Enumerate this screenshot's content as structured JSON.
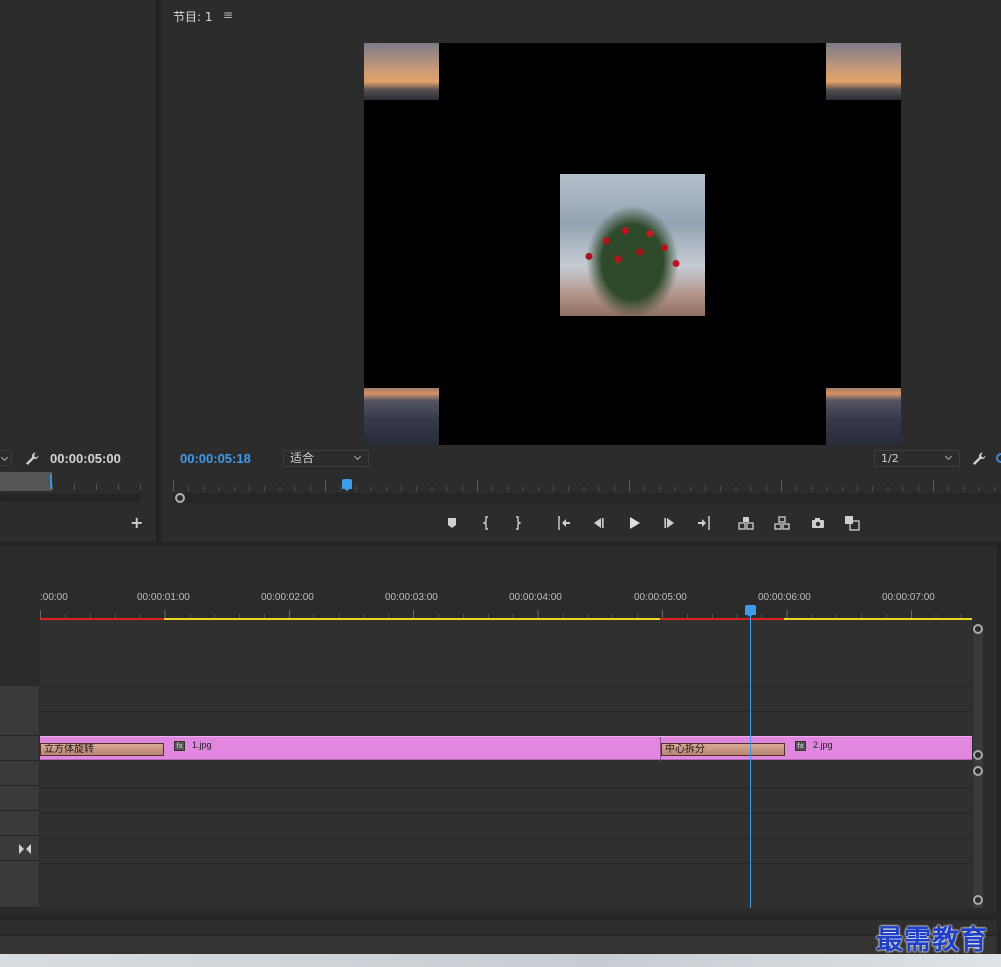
{
  "source": {
    "timecode": "00:00:05:00",
    "add_label": "+"
  },
  "program": {
    "title": "节目: 1",
    "menu_icon": "≡",
    "timecode": "00:00:05:18",
    "fit_select": "适合",
    "resolution_select": "1/2",
    "playhead_position_seconds": 5.75
  },
  "transport": [
    {
      "name": "add-marker-icon"
    },
    {
      "name": "mark-in-icon"
    },
    {
      "name": "mark-out-icon"
    },
    {
      "name": "go-to-in-icon"
    },
    {
      "name": "step-back-icon"
    },
    {
      "name": "play-icon"
    },
    {
      "name": "step-forward-icon"
    },
    {
      "name": "go-to-out-icon"
    },
    {
      "name": "lift-icon"
    },
    {
      "name": "extract-icon"
    },
    {
      "name": "export-frame-icon"
    },
    {
      "name": "comparison-view-icon"
    }
  ],
  "timeline": {
    "ruler_labels": [
      ":00:00",
      "00:00:01:00",
      "00:00:02:00",
      "00:00:03:00",
      "00:00:04:00",
      "00:00:05:00",
      "00:00:06:00",
      "00:00:07:00"
    ],
    "clips": [
      {
        "transition": "立方体旋转",
        "fx": "fx",
        "name": "1.jpg"
      },
      {
        "transition": "中心拆分",
        "fx": "fx",
        "name": "2.jpg"
      }
    ],
    "colors": {
      "clip": "#e187e0",
      "playhead": "#3d9be9",
      "render_red": "#e02020",
      "render_yellow": "#e8d820"
    }
  },
  "watermark": "最需教育"
}
